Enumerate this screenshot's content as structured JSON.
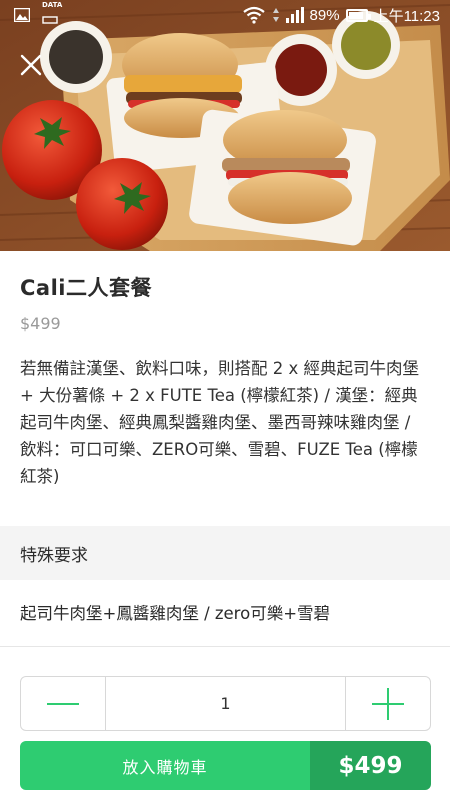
{
  "status_bar": {
    "data_label": "DATA",
    "battery_percent": "89%",
    "battery_level": 0.89,
    "time": "上午11:23"
  },
  "hero": {
    "image": "burger-combo-photo"
  },
  "item": {
    "title": "Cali二人套餐",
    "price": "$499",
    "description": "若無備註漢堡、飲料口味，則搭配 2 x 經典起司牛肉堡 + 大份薯條 + 2 x FUTE Tea (檸檬紅茶) / 漢堡：經典起司牛肉堡、經典鳳梨醬雞肉堡、墨西哥辣味雞肉堡 / 飲料：可口可樂、ZERO可樂、雪碧、FUZE Tea (檸檬紅茶)"
  },
  "special_request": {
    "header": "特殊要求",
    "text": "起司牛肉堡+鳳醬雞肉堡 / zero可樂+雪碧"
  },
  "quantity": {
    "value": "1"
  },
  "cart": {
    "label": "放入購物車",
    "price": "$499"
  },
  "colors": {
    "accent_green": "#2ecc71",
    "accent_green_dark": "#25a55a"
  }
}
